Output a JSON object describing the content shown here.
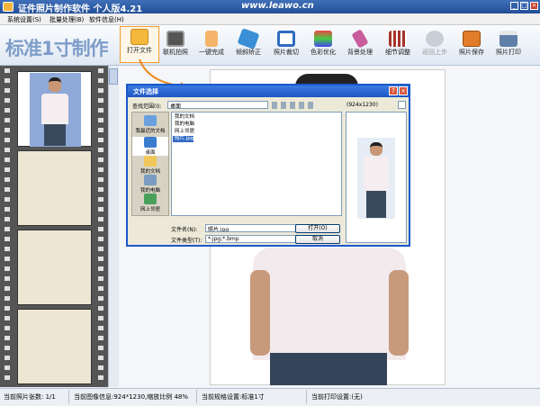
{
  "app": {
    "title": "证件照片制作软件 个人版4.21",
    "url": "www.leawo.cn"
  },
  "menu": [
    "系统设置(S)",
    "批量处理(B)",
    "软件信息(H)"
  ],
  "brand": "标准1寸制作",
  "toolbar": {
    "open": "打开文件",
    "camera": "联机拍照",
    "oneclick": "一键完成",
    "tilt": "倾斜矫正",
    "crop": "照片裁切",
    "color": "色彩优化",
    "bg": "背景处理",
    "detail": "细节调整",
    "undo": "返回上步",
    "save": "照片保存",
    "print": "照片打印"
  },
  "dialog": {
    "title": "文件选择",
    "lookin_label": "查找范围(I):",
    "lookin_value": "桌面",
    "size_info": "(924x1230)",
    "places": [
      "我最近的文档",
      "桌面",
      "我的文档",
      "我的电脑",
      "网上邻居"
    ],
    "files": [
      "我的文档",
      "我的电脑",
      "网上邻居",
      "照片.jpg"
    ],
    "filename_label": "文件名(N):",
    "filename_value": "照片.jpg",
    "filetype_label": "文件类型(T):",
    "filetype_value": "*.jpg;*.bmp",
    "open_btn": "打开(O)",
    "cancel_btn": "取消"
  },
  "status": {
    "count": "当前照片张数: 1/1",
    "info": "当前图像信息:924*1230,缩放比例 48%",
    "spec": "当前规格设置:标准1寸",
    "print": "当前打印设置:(无)"
  },
  "colors": {
    "accent": "#f29a2a",
    "titlebar": "#2f5ea8",
    "brand": "#7e9dc9"
  }
}
